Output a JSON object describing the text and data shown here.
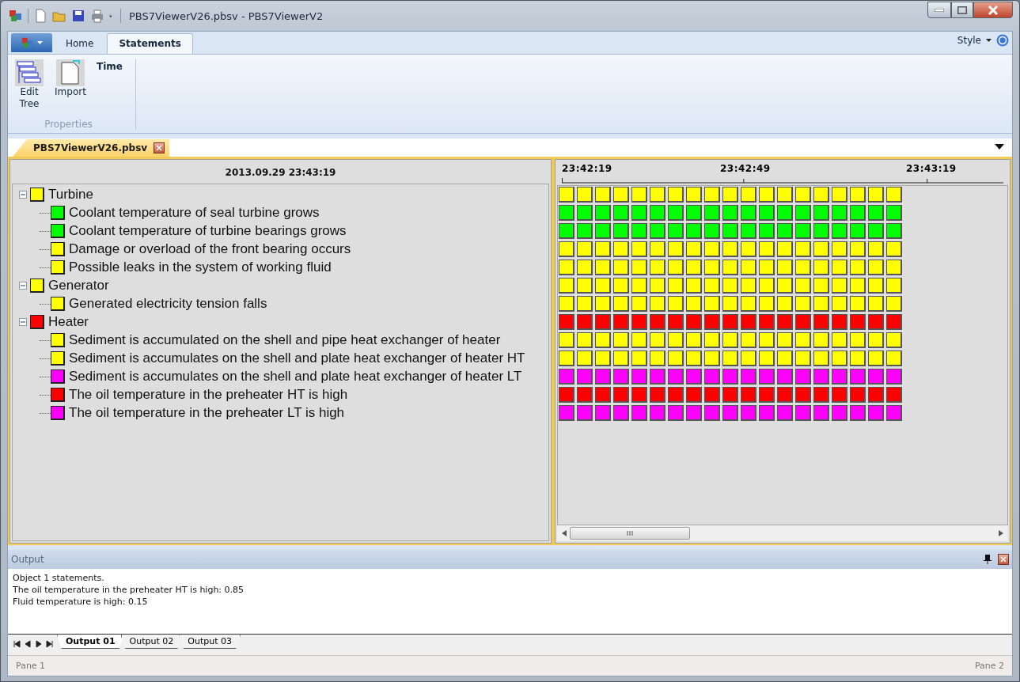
{
  "window": {
    "title": "PBS7ViewerV26.pbsv - PBS7ViewerV2"
  },
  "ribbon": {
    "tabs": [
      {
        "label": "Home",
        "selected": false
      },
      {
        "label": "Statements",
        "selected": true
      }
    ],
    "style_menu": "Style",
    "group": {
      "label": "Properties",
      "buttons": [
        {
          "label": "Edit Tree",
          "kind": "tree"
        },
        {
          "label": "Import",
          "kind": "document"
        },
        {
          "label": "Time",
          "kind": "text"
        }
      ]
    }
  },
  "documents": [
    {
      "label": "PBS7ViewerV26.pbsv",
      "selected": true
    }
  ],
  "tree": {
    "header": "2013.09.29 23:43:19",
    "items": [
      {
        "label": "Turbine",
        "color": "#ffff00",
        "expanded": true,
        "children": [
          {
            "label": "Coolant temperature of seal turbine grows",
            "color": "#00ff00"
          },
          {
            "label": "Coolant temperature of turbine bearings grows",
            "color": "#00ff00"
          },
          {
            "label": "Damage or overload of the front bearing occurs",
            "color": "#ffff00"
          },
          {
            "label": "Possible leaks in the system of working fluid",
            "color": "#ffff00"
          }
        ]
      },
      {
        "label": "Generator",
        "color": "#ffff00",
        "expanded": true,
        "children": [
          {
            "label": "Generated electricity tension falls",
            "color": "#ffff00"
          }
        ]
      },
      {
        "label": "Heater",
        "color": "#ff0000",
        "expanded": true,
        "children": [
          {
            "label": "Sediment is accumulated on the shell and pipe heat exchanger of heater",
            "color": "#ffff00"
          },
          {
            "label": "Sediment is accumulates on the shell and plate heat exchanger of heater HT",
            "color": "#ffff00"
          },
          {
            "label": "Sediment is accumulates on the shell and plate heat exchanger of heater LT",
            "color": "#ff00ff"
          },
          {
            "label": "The oil temperature in the preheater HT is high",
            "color": "#ff0000"
          },
          {
            "label": "The oil temperature in the preheater LT is high",
            "color": "#ff00ff"
          }
        ]
      }
    ]
  },
  "timeline": {
    "ticks": [
      "23:42:19",
      "23:42:49",
      "23:43:19"
    ]
  },
  "output": {
    "title": "Output",
    "lines": [
      "Object 1 statements.",
      "The oil temperature in the preheater HT is high: 0.85",
      "Fluid temperature is high: 0.15"
    ],
    "tabs": [
      {
        "label": "Output 01",
        "selected": true
      },
      {
        "label": "Output 02",
        "selected": false
      },
      {
        "label": "Output 03",
        "selected": false
      }
    ]
  },
  "status_bar": [
    "Pane 1",
    "Pane 2"
  ]
}
